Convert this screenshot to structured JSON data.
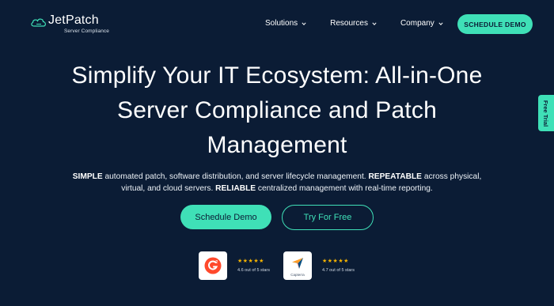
{
  "header": {
    "logo_name": "JetPatch",
    "logo_sub": "Server Compliance",
    "nav": [
      "Solutions",
      "Resources",
      "Company"
    ],
    "cta": "SCHEDULE DEMO"
  },
  "hero": {
    "title_line1": "Simplify Your IT Ecosystem: All-in-One",
    "title_line2": "Server Compliance and Patch",
    "title_line3": "Management",
    "desc_b1": "SIMPLE",
    "desc_t1": " automated patch, software distribution, and server lifecycle management. ",
    "desc_b2": "REPEATABLE",
    "desc_t2": " across physical, virtual, and cloud servers. ",
    "desc_b3": "RELIABLE",
    "desc_t3": " centralized management with real-time reporting.",
    "primary_button": "Schedule Demo",
    "secondary_button": "Try For Free"
  },
  "ratings": [
    {
      "icon": "g2-icon",
      "stars": "★★★★★",
      "value": 4.6,
      "text": "4.6 out of 5 stars"
    },
    {
      "icon": "capterra-icon",
      "label": "Capterra",
      "stars": "★★★★★",
      "value": 4.7,
      "text": "4.7 out of 5 stars"
    }
  ],
  "side_tab": "Free Trial",
  "colors": {
    "background": "#0b1c35",
    "accent": "#3fe0b7",
    "star": "#f5b301",
    "g2_red": "#ff492c"
  }
}
